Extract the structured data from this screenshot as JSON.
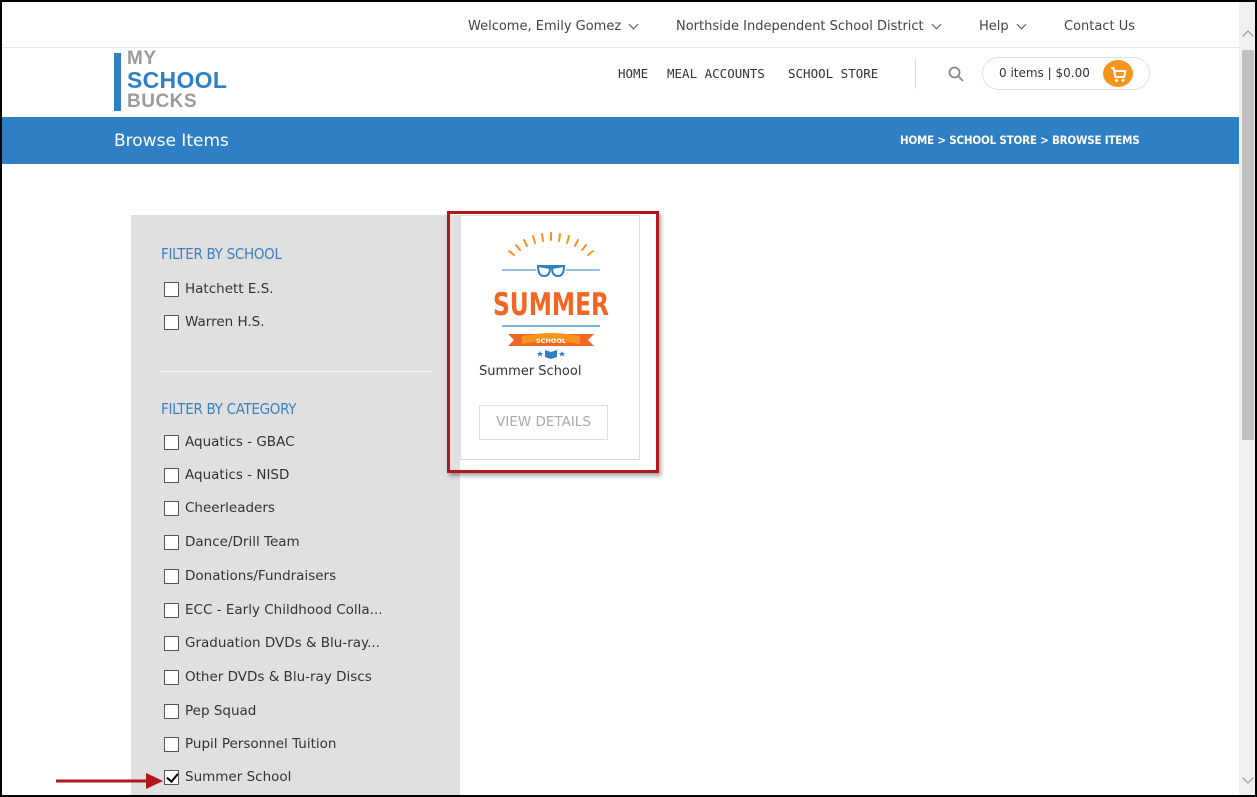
{
  "topbar": {
    "welcome": "Welcome, Emily Gomez",
    "district": "Northside Independent School District",
    "help": "Help",
    "contact": "Contact Us"
  },
  "logo": {
    "line1": "MY",
    "line2": "SCHOOL",
    "line3": "BUCKS"
  },
  "nav": {
    "home": "HOME",
    "meal_accounts": "MEAL ACCOUNTS",
    "school_store": "SCHOOL STORE",
    "search_icon": "search-icon",
    "cart_text": "0 items | $0.00",
    "cart_icon": "cart-icon"
  },
  "page": {
    "title": "Browse Items",
    "breadcrumb": "HOME  >  SCHOOL STORE  >  BROWSE ITEMS"
  },
  "filters": {
    "school_heading": "Filter by School",
    "schools": [
      {
        "label": "Hatchett E.S.",
        "checked": false
      },
      {
        "label": "Warren H.S.",
        "checked": false
      }
    ],
    "category_heading": "Filter by Category",
    "categories": [
      {
        "label": "Aquatics - GBAC",
        "checked": false
      },
      {
        "label": "Aquatics - NISD",
        "checked": false
      },
      {
        "label": "Cheerleaders",
        "checked": false
      },
      {
        "label": "Dance/Drill Team",
        "checked": false
      },
      {
        "label": "Donations/Fundraisers",
        "checked": false
      },
      {
        "label": "ECC - Early Childhood Colla...",
        "checked": false
      },
      {
        "label": "Graduation DVDs & Blu-ray...",
        "checked": false
      },
      {
        "label": "Other DVDs & Blu-ray Discs",
        "checked": false
      },
      {
        "label": "Pep Squad",
        "checked": false
      },
      {
        "label": "Pupil Personnel Tuition",
        "checked": false
      },
      {
        "label": "Summer School",
        "checked": true
      }
    ]
  },
  "product": {
    "art_title": "SUMMER",
    "art_ribbon": "SCHOOL",
    "name": "Summer School",
    "button": "VIEW DETAILS"
  },
  "colors": {
    "brand_blue": "#2f7fc4",
    "accent_orange": "#f7941d",
    "highlight_red": "#b3161d"
  }
}
